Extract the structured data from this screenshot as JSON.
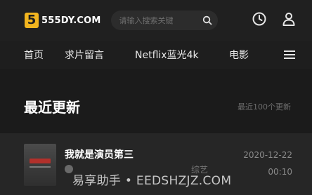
{
  "header": {
    "logo_badge": "5",
    "logo_text": "555DY.COM",
    "search_placeholder": "请输入搜索关键",
    "icons": [
      "search-icon",
      "history-icon",
      "user-icon"
    ]
  },
  "nav": {
    "items": [
      "首页",
      "求片留言",
      "Netflix蓝光4k",
      "电影"
    ],
    "menu_icon": "menu-icon"
  },
  "section": {
    "title": "最近更新",
    "more": "最近100个更新"
  },
  "item": {
    "title": "我就是演员第三",
    "category": "综艺",
    "date": "2020-12-22",
    "duration": "00:10"
  },
  "watermark": "易享助手 • EEDSHZJZ.COM",
  "colors": {
    "background": "#1b1b1b",
    "logo_accent": "#f2b51f",
    "thumb_accent": "#b2302b"
  }
}
